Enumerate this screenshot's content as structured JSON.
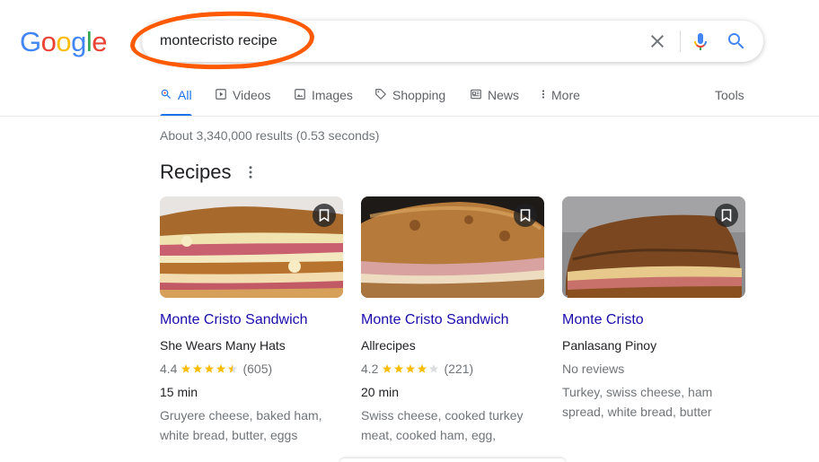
{
  "search": {
    "query": "montecristo recipe",
    "logo_letters": [
      {
        "ch": "G",
        "color": "#4285F4"
      },
      {
        "ch": "o",
        "color": "#EA4335"
      },
      {
        "ch": "o",
        "color": "#FBBC05"
      },
      {
        "ch": "g",
        "color": "#4285F4"
      },
      {
        "ch": "l",
        "color": "#34A853"
      },
      {
        "ch": "e",
        "color": "#EA4335"
      }
    ]
  },
  "tabs": [
    {
      "label": "All",
      "icon": "search-icon",
      "active": true
    },
    {
      "label": "Videos",
      "icon": "play-icon"
    },
    {
      "label": "Images",
      "icon": "image-icon"
    },
    {
      "label": "Shopping",
      "icon": "tag-icon"
    },
    {
      "label": "News",
      "icon": "news-icon"
    },
    {
      "label": "More",
      "icon": "more-vert-icon"
    },
    {
      "label": "Tools"
    }
  ],
  "results": {
    "count_text": "About 3,340,000 results (0.53 seconds)"
  },
  "recipes": {
    "heading": "Recipes",
    "cards": [
      {
        "title": "Monte Cristo Sandwich",
        "source": "She Wears Many Hats",
        "rating": "4.4",
        "stars": 4.5,
        "reviews": "(605)",
        "time": "15 min",
        "ingredients_1": "Gruyere cheese, baked ham,",
        "ingredients_2": "white bread, butter, eggs"
      },
      {
        "title": "Monte Cristo Sandwich",
        "source": "Allrecipes",
        "rating": "4.2",
        "stars": 4,
        "reviews": "(221)",
        "time": "20 min",
        "ingredients_1": "Swiss cheese, cooked turkey",
        "ingredients_2": "meat, cooked ham, egg,"
      },
      {
        "title": "Monte Cristo",
        "source": "Panlasang Pinoy",
        "no_reviews": "No reviews",
        "ingredients_1": "Turkey, swiss cheese, ham",
        "ingredients_2": "spread, white bread, butter"
      }
    ]
  },
  "colors": {
    "link": "#1a0dab",
    "accent": "#1a73e8",
    "star": "#fbbc04",
    "annotation": "#ff5a00"
  }
}
